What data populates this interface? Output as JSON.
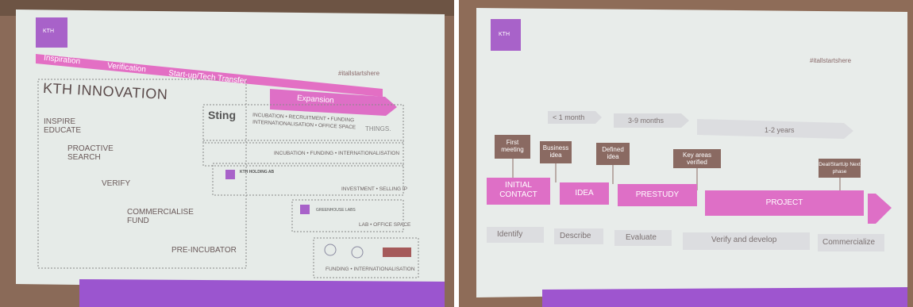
{
  "left": {
    "phases": [
      "Inspiration",
      "Verification",
      "Start-up/Tech Transfer",
      "Expansion"
    ],
    "hashtag": "#itallstartshere",
    "logo": "KTH",
    "org_title": "KTH INNOVATION",
    "steps": [
      "INSPIRE",
      "EDUCATE",
      "PROACTIVE",
      "SEARCH",
      "VERIFY",
      "COMMERCIALISE",
      "FUND",
      "PRE-INCUBATOR"
    ],
    "sting": "Sting",
    "sting_desc1": "INCUBATION • RECRUITMENT • FUNDING",
    "sting_desc2": "INTERNATIONALISATION • OFFICE SPACE",
    "things": "THINGS.",
    "row2": "INCUBATION • FUNDING • INTERNATIONALISATION",
    "holding": "KTH HOLDING AB",
    "row3": "INVESTMENT • SELLING IP",
    "greenhouse": "GREENHOUSE LABS",
    "row4": "LAB • OFFICE SPACE",
    "row5": "FUNDING • INTERNATIONALISATION"
  },
  "right": {
    "logo": "KTH",
    "hashtag": "#itallstartshere",
    "durations": [
      "< 1 month",
      "3-9 months",
      "1-2 years"
    ],
    "milestones": [
      "First meeting",
      "Business idea",
      "Defined idea",
      "Key areas verified",
      "Deal/StartUp Next phase"
    ],
    "phases": [
      "INITIAL CONTACT",
      "IDEA",
      "PRESTUDY",
      "PROJECT"
    ],
    "verbs": [
      "Identify",
      "Describe",
      "Evaluate",
      "Verify and develop",
      "Commercialize"
    ]
  },
  "colors": {
    "pink": "#de6fc6",
    "violet": "#a54dc9",
    "brown": "#8a6a62",
    "screen": "#e9edeb"
  }
}
